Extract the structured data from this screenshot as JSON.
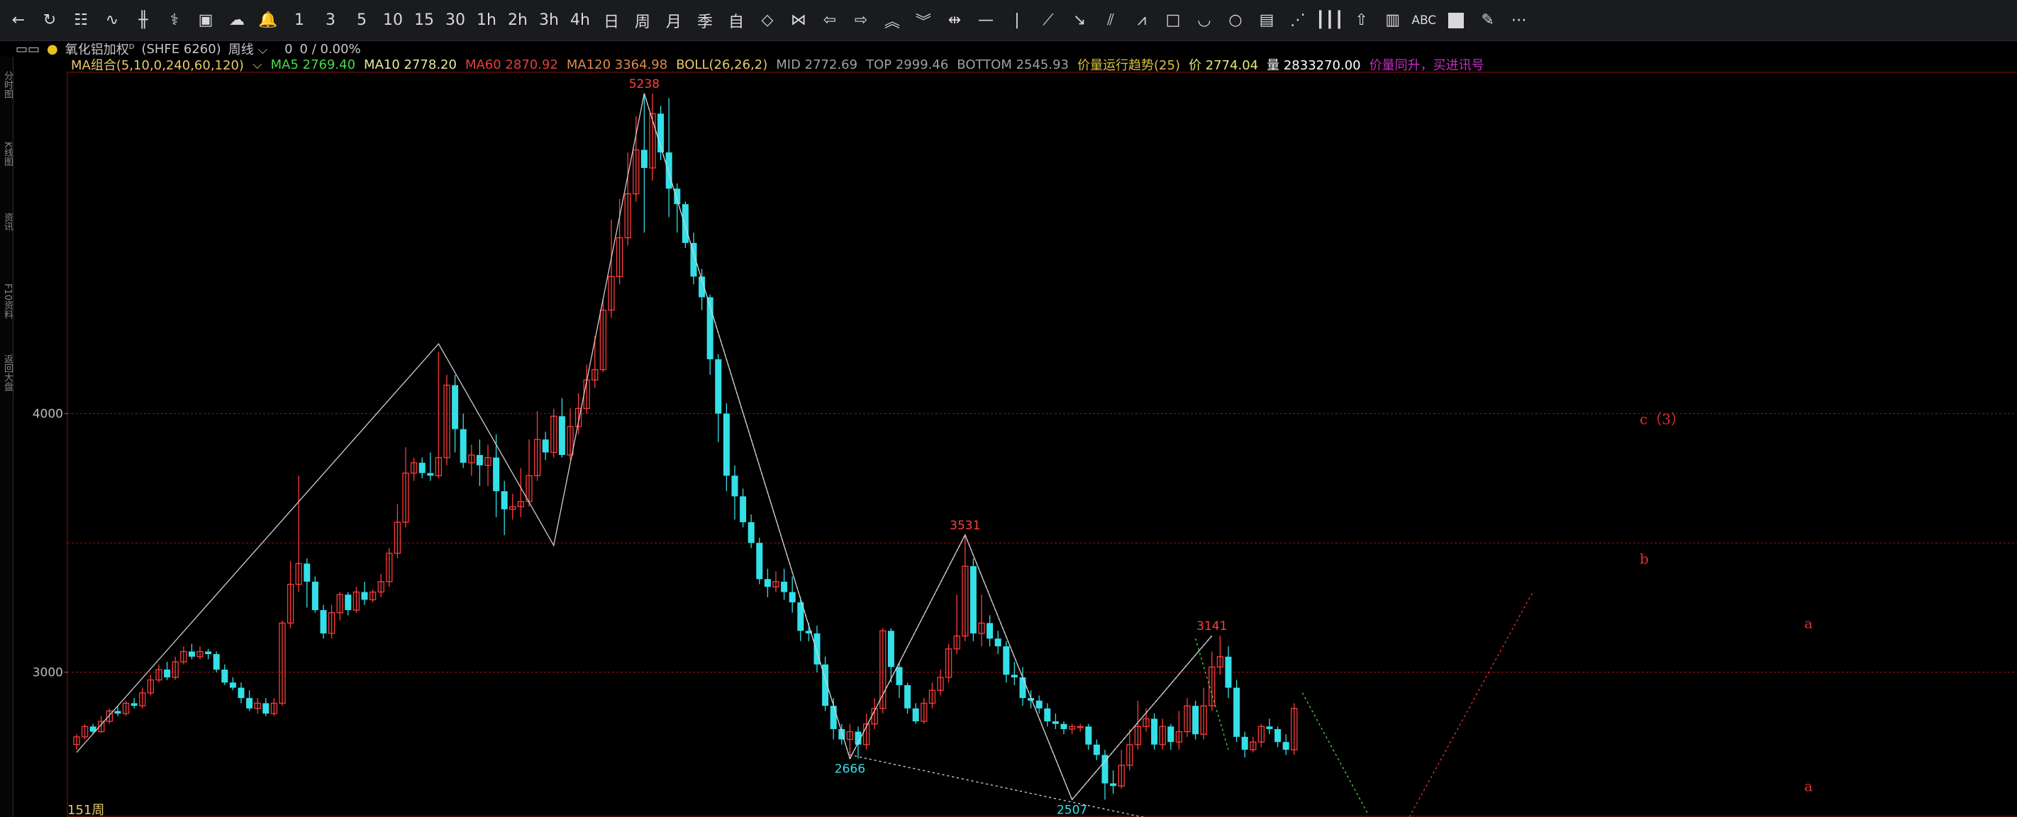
{
  "toolbar": {
    "items": [
      {
        "kind": "icon",
        "name": "back-arrow-icon",
        "glyph": "←"
      },
      {
        "kind": "icon",
        "name": "refresh-icon",
        "glyph": "↻"
      },
      {
        "kind": "icon",
        "name": "grid-table-icon",
        "glyph": "☷"
      },
      {
        "kind": "icon",
        "name": "line-chart-icon",
        "glyph": "∿"
      },
      {
        "kind": "icon",
        "name": "candlestick-icon",
        "glyph": "╫"
      },
      {
        "kind": "icon",
        "name": "indicator-icon",
        "glyph": "⚕"
      },
      {
        "kind": "icon",
        "name": "layout-icon",
        "glyph": "▣"
      },
      {
        "kind": "icon",
        "name": "cloud-sync-icon",
        "glyph": "☁"
      },
      {
        "kind": "icon",
        "name": "alarm-bell-icon",
        "glyph": "🔔"
      },
      {
        "kind": "text",
        "name": "period-1min",
        "label": "1"
      },
      {
        "kind": "text",
        "name": "period-3min",
        "label": "3"
      },
      {
        "kind": "text",
        "name": "period-5min",
        "label": "5"
      },
      {
        "kind": "text",
        "name": "period-10min",
        "label": "10"
      },
      {
        "kind": "text",
        "name": "period-15min",
        "label": "15"
      },
      {
        "kind": "text",
        "name": "period-30min",
        "label": "30"
      },
      {
        "kind": "text",
        "name": "period-1h",
        "label": "1h"
      },
      {
        "kind": "text",
        "name": "period-2h",
        "label": "2h"
      },
      {
        "kind": "text",
        "name": "period-3h",
        "label": "3h"
      },
      {
        "kind": "text",
        "name": "period-4h",
        "label": "4h"
      },
      {
        "kind": "text",
        "name": "period-day",
        "label": "日"
      },
      {
        "kind": "text",
        "name": "period-week",
        "label": "周"
      },
      {
        "kind": "text",
        "name": "period-month",
        "label": "月"
      },
      {
        "kind": "text",
        "name": "period-quarter",
        "label": "季"
      },
      {
        "kind": "text",
        "name": "period-custom",
        "label": "自"
      },
      {
        "kind": "icon",
        "name": "diamond-icon",
        "glyph": "◇"
      },
      {
        "kind": "icon",
        "name": "bowtie-icon",
        "glyph": "⋈"
      },
      {
        "kind": "icon",
        "name": "arrow-left-icon",
        "glyph": "⇦"
      },
      {
        "kind": "icon",
        "name": "arrow-right-icon",
        "glyph": "⇨"
      },
      {
        "kind": "icon",
        "name": "zoom-in-icon",
        "glyph": "︽"
      },
      {
        "kind": "icon",
        "name": "zoom-out-icon",
        "glyph": "︾"
      },
      {
        "kind": "icon",
        "name": "crosshair-move-icon",
        "glyph": "⇹"
      },
      {
        "kind": "icon",
        "name": "horizontal-line-icon",
        "glyph": "—"
      },
      {
        "kind": "icon",
        "name": "vertical-line-icon",
        "glyph": "|"
      },
      {
        "kind": "icon",
        "name": "trend-line-icon",
        "glyph": "⟋"
      },
      {
        "kind": "icon",
        "name": "ray-down-icon",
        "glyph": "↘"
      },
      {
        "kind": "icon",
        "name": "parallel-lines-icon",
        "glyph": "⫽"
      },
      {
        "kind": "icon",
        "name": "wave-line-icon",
        "glyph": "⩘"
      },
      {
        "kind": "icon",
        "name": "rectangle-icon",
        "glyph": "□"
      },
      {
        "kind": "icon",
        "name": "arc-icon",
        "glyph": "◡"
      },
      {
        "kind": "icon",
        "name": "circle-icon",
        "glyph": "○"
      },
      {
        "kind": "icon",
        "name": "fib-icon",
        "glyph": "▤"
      },
      {
        "kind": "icon",
        "name": "gann-fan-icon",
        "glyph": "⋰"
      },
      {
        "kind": "icon",
        "name": "period-lines-icon",
        "glyph": "┃┃┃"
      },
      {
        "kind": "icon",
        "name": "up-arrow-icon",
        "glyph": "⇧"
      },
      {
        "kind": "icon",
        "name": "ruler-icon",
        "glyph": "▥"
      },
      {
        "kind": "text",
        "name": "text-tool-abc",
        "label": "ABC"
      },
      {
        "kind": "square",
        "name": "color-swatch-icon",
        "glyph": ""
      },
      {
        "kind": "icon",
        "name": "eraser-icon",
        "glyph": "✎"
      },
      {
        "kind": "icon",
        "name": "more-icon",
        "glyph": "⋯"
      }
    ]
  },
  "infobar": {
    "link_glyph": "▭▭",
    "dot": "●",
    "symbol": "氧化铝加权",
    "symbol_sup": "D",
    "code": "(SHFE 6260)",
    "period": "周线",
    "period_caret": "⌵",
    "change": "0",
    "change_pct": "0 / 0.00%"
  },
  "indicators": [
    {
      "label": "MA组合(5,10,0,240,60,120)",
      "color": "#e8c86a"
    },
    {
      "label": "⌵",
      "color": "#e8c86a"
    },
    {
      "label": "MA5 2769.40",
      "color": "#4ad94a"
    },
    {
      "label": "MA10 2778.20",
      "color": "#e8e8a0"
    },
    {
      "label": "MA60 2870.92",
      "color": "#e04040"
    },
    {
      "label": "MA120 3364.98",
      "color": "#e08a4a"
    },
    {
      "label": "BOLL(26,26,2)",
      "color": "#e8c86a"
    },
    {
      "label": "MID 2772.69",
      "color": "#a0a0a0"
    },
    {
      "label": "TOP 2999.46",
      "color": "#a0a0a0"
    },
    {
      "label": "BOTTOM 2545.93",
      "color": "#a0a0a0"
    },
    {
      "label": "价量运行趋势(25)",
      "color": "#d8c040"
    },
    {
      "label": "价 2774.04",
      "color": "#e8e870"
    },
    {
      "label": "量 2833270.00",
      "color": "#ffffff"
    },
    {
      "label": "价量同升，买进讯号",
      "color": "#c030c0"
    }
  ],
  "leftstrip": [
    "分时图",
    "K线图",
    "资讯",
    "F10资料",
    "返回大盘"
  ],
  "colors": {
    "up": "#ff3b3b",
    "down": "#33e0e8",
    "grid": "#8a1010",
    "zigzag": "#cfcfcf"
  },
  "chart_data": {
    "type": "candlestick",
    "period_count_label": "151周",
    "y_ticks": [
      3000,
      4000
    ],
    "y_range": [
      2440,
      5320
    ],
    "dashed_levels": [
      4000,
      3500,
      3000
    ],
    "candles": [
      [
        2720,
        2750,
        2700,
        2760
      ],
      [
        2750,
        2790,
        2740,
        2800
      ],
      [
        2790,
        2770,
        2760,
        2800
      ],
      [
        2770,
        2810,
        2765,
        2830
      ],
      [
        2810,
        2850,
        2800,
        2860
      ],
      [
        2850,
        2840,
        2830,
        2870
      ],
      [
        2840,
        2880,
        2830,
        2890
      ],
      [
        2880,
        2870,
        2860,
        2900
      ],
      [
        2870,
        2920,
        2860,
        2940
      ],
      [
        2920,
        2970,
        2910,
        2990
      ],
      [
        2970,
        3010,
        2960,
        3030
      ],
      [
        3010,
        2980,
        2970,
        3040
      ],
      [
        2980,
        3040,
        2970,
        3060
      ],
      [
        3040,
        3080,
        3030,
        3100
      ],
      [
        3080,
        3060,
        3050,
        3110
      ],
      [
        3060,
        3080,
        3050,
        3100
      ],
      [
        3080,
        3070,
        3050,
        3090
      ],
      [
        3070,
        3010,
        3000,
        3080
      ],
      [
        3010,
        2960,
        2950,
        3030
      ],
      [
        2960,
        2940,
        2930,
        2980
      ],
      [
        2940,
        2900,
        2880,
        2960
      ],
      [
        2900,
        2860,
        2850,
        2930
      ],
      [
        2860,
        2880,
        2840,
        2900
      ],
      [
        2880,
        2840,
        2830,
        2900
      ],
      [
        2840,
        2880,
        2830,
        2900
      ],
      [
        2880,
        3190,
        2870,
        3200
      ],
      [
        3190,
        3340,
        3170,
        3430
      ],
      [
        3340,
        3420,
        3310,
        3760
      ],
      [
        3420,
        3350,
        3250,
        3440
      ],
      [
        3350,
        3240,
        3230,
        3370
      ],
      [
        3240,
        3150,
        3130,
        3260
      ],
      [
        3150,
        3230,
        3130,
        3260
      ],
      [
        3230,
        3300,
        3200,
        3310
      ],
      [
        3300,
        3240,
        3220,
        3310
      ],
      [
        3240,
        3310,
        3230,
        3330
      ],
      [
        3310,
        3280,
        3260,
        3350
      ],
      [
        3280,
        3310,
        3270,
        3320
      ],
      [
        3310,
        3350,
        3290,
        3380
      ],
      [
        3350,
        3460,
        3330,
        3480
      ],
      [
        3460,
        3580,
        3440,
        3650
      ],
      [
        3580,
        3770,
        3560,
        3870
      ],
      [
        3770,
        3810,
        3740,
        3830
      ],
      [
        3810,
        3770,
        3750,
        3830
      ],
      [
        3770,
        3760,
        3740,
        3850
      ],
      [
        3760,
        3830,
        3750,
        4240
      ],
      [
        3830,
        4110,
        3800,
        4150
      ],
      [
        4110,
        3940,
        3850,
        4150
      ],
      [
        3940,
        3810,
        3790,
        4000
      ],
      [
        3810,
        3840,
        3760,
        3880
      ],
      [
        3840,
        3800,
        3720,
        3900
      ],
      [
        3800,
        3830,
        3720,
        3880
      ],
      [
        3830,
        3700,
        3600,
        3920
      ],
      [
        3700,
        3630,
        3530,
        3740
      ],
      [
        3630,
        3640,
        3590,
        3690
      ],
      [
        3640,
        3660,
        3600,
        3790
      ],
      [
        3660,
        3760,
        3640,
        3900
      ],
      [
        3760,
        3900,
        3740,
        4010
      ],
      [
        3900,
        3850,
        3820,
        3930
      ],
      [
        3850,
        3990,
        3830,
        4020
      ],
      [
        3990,
        3840,
        3830,
        4060
      ],
      [
        3840,
        3950,
        3820,
        4020
      ],
      [
        3950,
        4020,
        3920,
        4080
      ],
      [
        4020,
        4130,
        4000,
        4190
      ],
      [
        4130,
        4170,
        4100,
        4300
      ],
      [
        4170,
        4400,
        4160,
        4440
      ],
      [
        4400,
        4530,
        4370,
        4750
      ],
      [
        4530,
        4680,
        4500,
        4830
      ],
      [
        4680,
        4850,
        4650,
        5010
      ],
      [
        4850,
        5020,
        4820,
        5150
      ],
      [
        5020,
        4950,
        4700,
        5238
      ],
      [
        4950,
        5160,
        4900,
        5238
      ],
      [
        5160,
        5010,
        4980,
        5190
      ],
      [
        5010,
        4870,
        4760,
        5220
      ],
      [
        4870,
        4810,
        4700,
        4890
      ],
      [
        4810,
        4660,
        4640,
        4820
      ],
      [
        4660,
        4530,
        4500,
        4700
      ],
      [
        4530,
        4450,
        4400,
        4560
      ],
      [
        4450,
        4210,
        4150,
        4460
      ],
      [
        4210,
        4000,
        3890,
        4230
      ],
      [
        4000,
        3760,
        3700,
        4040
      ],
      [
        3760,
        3680,
        3590,
        3800
      ],
      [
        3680,
        3580,
        3560,
        3710
      ],
      [
        3580,
        3500,
        3480,
        3610
      ],
      [
        3500,
        3360,
        3340,
        3520
      ],
      [
        3360,
        3330,
        3290,
        3400
      ],
      [
        3330,
        3350,
        3310,
        3390
      ],
      [
        3350,
        3310,
        3280,
        3400
      ],
      [
        3310,
        3270,
        3230,
        3370
      ],
      [
        3270,
        3160,
        3120,
        3290
      ],
      [
        3160,
        3150,
        3120,
        3190
      ],
      [
        3150,
        3030,
        3000,
        3180
      ],
      [
        3030,
        2870,
        2850,
        3060
      ],
      [
        2870,
        2780,
        2740,
        2900
      ],
      [
        2780,
        2740,
        2720,
        2800
      ],
      [
        2740,
        2770,
        2680,
        2800
      ],
      [
        2770,
        2720,
        2666,
        2790
      ],
      [
        2720,
        2800,
        2700,
        2840
      ],
      [
        2800,
        2860,
        2780,
        2900
      ],
      [
        2860,
        3160,
        2840,
        3170
      ],
      [
        3160,
        3020,
        2960,
        3170
      ],
      [
        3020,
        2950,
        2900,
        3040
      ],
      [
        2950,
        2860,
        2840,
        2960
      ],
      [
        2860,
        2810,
        2800,
        2880
      ],
      [
        2810,
        2880,
        2800,
        2900
      ],
      [
        2880,
        2930,
        2860,
        2960
      ],
      [
        2930,
        2980,
        2910,
        3010
      ],
      [
        2980,
        3090,
        2960,
        3110
      ],
      [
        3090,
        3140,
        3070,
        3300
      ],
      [
        3140,
        3410,
        3120,
        3531
      ],
      [
        3410,
        3150,
        3120,
        3440
      ],
      [
        3150,
        3190,
        3100,
        3300
      ],
      [
        3190,
        3130,
        3100,
        3220
      ],
      [
        3130,
        3100,
        3070,
        3160
      ],
      [
        3100,
        2990,
        2960,
        3120
      ],
      [
        2990,
        2980,
        2950,
        3040
      ],
      [
        2980,
        2900,
        2870,
        3020
      ],
      [
        2900,
        2890,
        2860,
        2930
      ],
      [
        2890,
        2860,
        2840,
        2910
      ],
      [
        2860,
        2810,
        2790,
        2880
      ],
      [
        2810,
        2800,
        2780,
        2840
      ],
      [
        2800,
        2780,
        2760,
        2810
      ],
      [
        2780,
        2790,
        2760,
        2800
      ],
      [
        2790,
        2790,
        2770,
        2800
      ],
      [
        2790,
        2720,
        2700,
        2800
      ],
      [
        2720,
        2680,
        2660,
        2740
      ],
      [
        2680,
        2570,
        2507,
        2700
      ],
      [
        2570,
        2560,
        2530,
        2620
      ],
      [
        2560,
        2640,
        2550,
        2700
      ],
      [
        2640,
        2720,
        2620,
        2780
      ],
      [
        2720,
        2790,
        2700,
        2890
      ],
      [
        2790,
        2820,
        2770,
        2860
      ],
      [
        2820,
        2720,
        2700,
        2840
      ],
      [
        2720,
        2790,
        2700,
        2820
      ],
      [
        2790,
        2730,
        2700,
        2800
      ],
      [
        2730,
        2770,
        2700,
        2850
      ],
      [
        2770,
        2870,
        2750,
        2900
      ],
      [
        2870,
        2760,
        2740,
        2890
      ],
      [
        2760,
        2870,
        2740,
        2940
      ],
      [
        2870,
        3020,
        2850,
        3080
      ],
      [
        3020,
        3060,
        2990,
        3141
      ],
      [
        3060,
        2940,
        2900,
        3100
      ],
      [
        2940,
        2750,
        2730,
        2970
      ],
      [
        2750,
        2700,
        2670,
        2770
      ],
      [
        2700,
        2730,
        2690,
        2750
      ],
      [
        2730,
        2790,
        2710,
        2800
      ],
      [
        2790,
        2780,
        2760,
        2820
      ],
      [
        2780,
        2730,
        2710,
        2790
      ],
      [
        2730,
        2700,
        2680,
        2760
      ],
      [
        2700,
        2860,
        2680,
        2880
      ]
    ],
    "annotations": [
      {
        "text": "5238",
        "candle": 69,
        "price": 5238,
        "color": "#ff4040",
        "pos": "top"
      },
      {
        "text": "3531",
        "candle": 108,
        "price": 3531,
        "color": "#ff4040",
        "pos": "top"
      },
      {
        "text": "3141",
        "candle": 138,
        "price": 3141,
        "color": "#ff4040",
        "pos": "top"
      },
      {
        "text": "2666",
        "candle": 94,
        "price": 2666,
        "color": "#33e0e8",
        "pos": "bottom"
      },
      {
        "text": "2507",
        "candle": 121,
        "price": 2507,
        "color": "#33e0e8",
        "pos": "bottom"
      }
    ],
    "wave_labels": [
      {
        "text": "c（3）",
        "candle": 190,
        "price": 3960,
        "color": "#e03030"
      },
      {
        "text": "b",
        "candle": 190,
        "price": 3420,
        "color": "#e03030"
      },
      {
        "text": "a",
        "candle": 210,
        "price": 3170,
        "color": "#e03030"
      },
      {
        "text": "a",
        "candle": 210,
        "price": 2540,
        "color": "#e03030"
      }
    ],
    "zigzag": [
      [
        0,
        2690
      ],
      [
        44,
        4270
      ],
      [
        58,
        3490
      ],
      [
        69,
        5238
      ],
      [
        94,
        2666
      ],
      [
        108,
        3531
      ],
      [
        121,
        2507
      ],
      [
        138,
        3141
      ]
    ],
    "dotted_lines": [
      {
        "from": [
          69,
          5238
        ],
        "to": [
          94,
          2666
        ],
        "color": "#cfcfcf"
      },
      {
        "from": [
          94,
          2666
        ],
        "to": [
          108,
          3531
        ],
        "color": "#cfcfcf"
      },
      {
        "from": [
          108,
          3531
        ],
        "to": [
          121,
          2507
        ],
        "color": "#cfcfcf"
      },
      {
        "from": [
          121,
          2507
        ],
        "to": [
          138,
          3141
        ],
        "color": "#cfcfcf"
      },
      {
        "from": [
          94,
          2680
        ],
        "to": [
          131,
          2430
        ],
        "color": "#cfcfcf"
      },
      {
        "from": [
          136,
          3130
        ],
        "to": [
          140,
          2700
        ],
        "color": "#40d040"
      },
      {
        "from": [
          149,
          2920
        ],
        "to": [
          157,
          2450
        ],
        "color": "#40d040"
      },
      {
        "from": [
          162,
          2440
        ],
        "to": [
          177,
          3310
        ],
        "color": "#e03030"
      }
    ]
  }
}
